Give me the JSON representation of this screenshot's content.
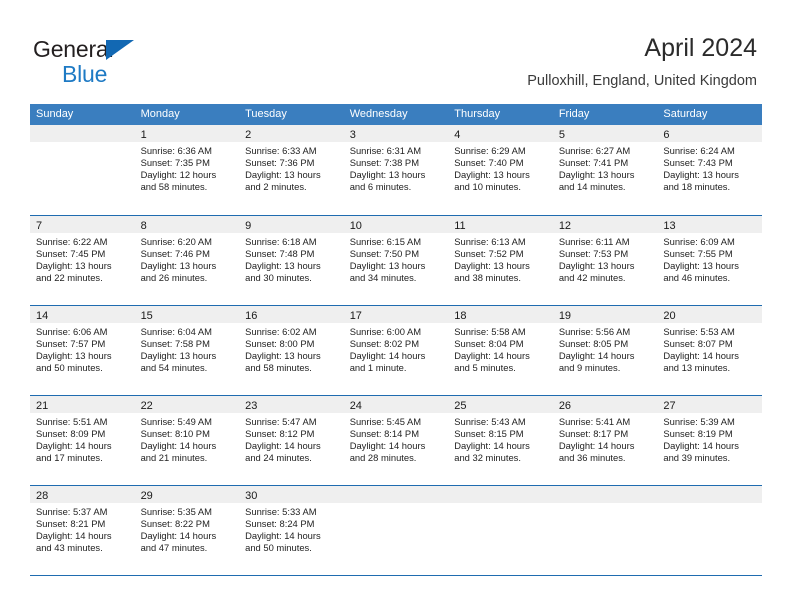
{
  "brand": {
    "line1": "General",
    "line2": "Blue",
    "triangle_icon": "triangle-logo-icon",
    "accent_color": "#1268b3"
  },
  "header": {
    "title": "April 2024",
    "subtitle": "Pulloxhill, England, United Kingdom"
  },
  "colors": {
    "header_band": "#3a7ebf",
    "row_divider": "#1f6cb0",
    "day_number_band": "#efefef",
    "text": "#222222"
  },
  "calendar": {
    "weekday_headers": [
      "Sunday",
      "Monday",
      "Tuesday",
      "Wednesday",
      "Thursday",
      "Friday",
      "Saturday"
    ],
    "weeks": [
      [
        {
          "day": "",
          "lines": []
        },
        {
          "day": "1",
          "lines": [
            "Sunrise: 6:36 AM",
            "Sunset: 7:35 PM",
            "Daylight: 12 hours",
            "and 58 minutes."
          ]
        },
        {
          "day": "2",
          "lines": [
            "Sunrise: 6:33 AM",
            "Sunset: 7:36 PM",
            "Daylight: 13 hours",
            "and 2 minutes."
          ]
        },
        {
          "day": "3",
          "lines": [
            "Sunrise: 6:31 AM",
            "Sunset: 7:38 PM",
            "Daylight: 13 hours",
            "and 6 minutes."
          ]
        },
        {
          "day": "4",
          "lines": [
            "Sunrise: 6:29 AM",
            "Sunset: 7:40 PM",
            "Daylight: 13 hours",
            "and 10 minutes."
          ]
        },
        {
          "day": "5",
          "lines": [
            "Sunrise: 6:27 AM",
            "Sunset: 7:41 PM",
            "Daylight: 13 hours",
            "and 14 minutes."
          ]
        },
        {
          "day": "6",
          "lines": [
            "Sunrise: 6:24 AM",
            "Sunset: 7:43 PM",
            "Daylight: 13 hours",
            "and 18 minutes."
          ]
        }
      ],
      [
        {
          "day": "7",
          "lines": [
            "Sunrise: 6:22 AM",
            "Sunset: 7:45 PM",
            "Daylight: 13 hours",
            "and 22 minutes."
          ]
        },
        {
          "day": "8",
          "lines": [
            "Sunrise: 6:20 AM",
            "Sunset: 7:46 PM",
            "Daylight: 13 hours",
            "and 26 minutes."
          ]
        },
        {
          "day": "9",
          "lines": [
            "Sunrise: 6:18 AM",
            "Sunset: 7:48 PM",
            "Daylight: 13 hours",
            "and 30 minutes."
          ]
        },
        {
          "day": "10",
          "lines": [
            "Sunrise: 6:15 AM",
            "Sunset: 7:50 PM",
            "Daylight: 13 hours",
            "and 34 minutes."
          ]
        },
        {
          "day": "11",
          "lines": [
            "Sunrise: 6:13 AM",
            "Sunset: 7:52 PM",
            "Daylight: 13 hours",
            "and 38 minutes."
          ]
        },
        {
          "day": "12",
          "lines": [
            "Sunrise: 6:11 AM",
            "Sunset: 7:53 PM",
            "Daylight: 13 hours",
            "and 42 minutes."
          ]
        },
        {
          "day": "13",
          "lines": [
            "Sunrise: 6:09 AM",
            "Sunset: 7:55 PM",
            "Daylight: 13 hours",
            "and 46 minutes."
          ]
        }
      ],
      [
        {
          "day": "14",
          "lines": [
            "Sunrise: 6:06 AM",
            "Sunset: 7:57 PM",
            "Daylight: 13 hours",
            "and 50 minutes."
          ]
        },
        {
          "day": "15",
          "lines": [
            "Sunrise: 6:04 AM",
            "Sunset: 7:58 PM",
            "Daylight: 13 hours",
            "and 54 minutes."
          ]
        },
        {
          "day": "16",
          "lines": [
            "Sunrise: 6:02 AM",
            "Sunset: 8:00 PM",
            "Daylight: 13 hours",
            "and 58 minutes."
          ]
        },
        {
          "day": "17",
          "lines": [
            "Sunrise: 6:00 AM",
            "Sunset: 8:02 PM",
            "Daylight: 14 hours",
            "and 1 minute."
          ]
        },
        {
          "day": "18",
          "lines": [
            "Sunrise: 5:58 AM",
            "Sunset: 8:04 PM",
            "Daylight: 14 hours",
            "and 5 minutes."
          ]
        },
        {
          "day": "19",
          "lines": [
            "Sunrise: 5:56 AM",
            "Sunset: 8:05 PM",
            "Daylight: 14 hours",
            "and 9 minutes."
          ]
        },
        {
          "day": "20",
          "lines": [
            "Sunrise: 5:53 AM",
            "Sunset: 8:07 PM",
            "Daylight: 14 hours",
            "and 13 minutes."
          ]
        }
      ],
      [
        {
          "day": "21",
          "lines": [
            "Sunrise: 5:51 AM",
            "Sunset: 8:09 PM",
            "Daylight: 14 hours",
            "and 17 minutes."
          ]
        },
        {
          "day": "22",
          "lines": [
            "Sunrise: 5:49 AM",
            "Sunset: 8:10 PM",
            "Daylight: 14 hours",
            "and 21 minutes."
          ]
        },
        {
          "day": "23",
          "lines": [
            "Sunrise: 5:47 AM",
            "Sunset: 8:12 PM",
            "Daylight: 14 hours",
            "and 24 minutes."
          ]
        },
        {
          "day": "24",
          "lines": [
            "Sunrise: 5:45 AM",
            "Sunset: 8:14 PM",
            "Daylight: 14 hours",
            "and 28 minutes."
          ]
        },
        {
          "day": "25",
          "lines": [
            "Sunrise: 5:43 AM",
            "Sunset: 8:15 PM",
            "Daylight: 14 hours",
            "and 32 minutes."
          ]
        },
        {
          "day": "26",
          "lines": [
            "Sunrise: 5:41 AM",
            "Sunset: 8:17 PM",
            "Daylight: 14 hours",
            "and 36 minutes."
          ]
        },
        {
          "day": "27",
          "lines": [
            "Sunrise: 5:39 AM",
            "Sunset: 8:19 PM",
            "Daylight: 14 hours",
            "and 39 minutes."
          ]
        }
      ],
      [
        {
          "day": "28",
          "lines": [
            "Sunrise: 5:37 AM",
            "Sunset: 8:21 PM",
            "Daylight: 14 hours",
            "and 43 minutes."
          ]
        },
        {
          "day": "29",
          "lines": [
            "Sunrise: 5:35 AM",
            "Sunset: 8:22 PM",
            "Daylight: 14 hours",
            "and 47 minutes."
          ]
        },
        {
          "day": "30",
          "lines": [
            "Sunrise: 5:33 AM",
            "Sunset: 8:24 PM",
            "Daylight: 14 hours",
            "and 50 minutes."
          ]
        },
        {
          "day": "",
          "lines": []
        },
        {
          "day": "",
          "lines": []
        },
        {
          "day": "",
          "lines": []
        },
        {
          "day": "",
          "lines": []
        }
      ]
    ]
  }
}
